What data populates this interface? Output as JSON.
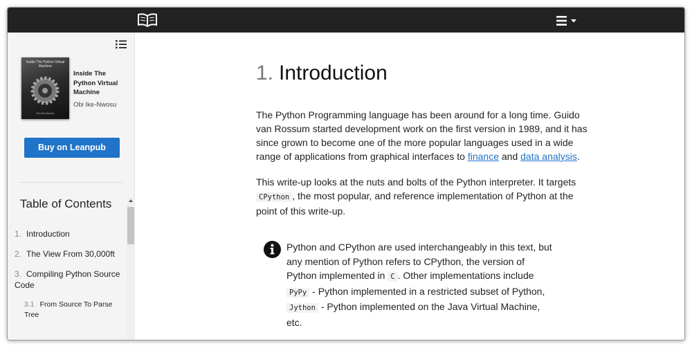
{
  "topbar": {
    "logo_icon": "open-book-icon",
    "menu_icon": "hamburger-menu-icon",
    "menu_caret_icon": "caret-down-icon",
    "background": "#222222"
  },
  "sidebar": {
    "toc_toggle_icon": "list-icon",
    "cover": {
      "title": "Inside The Python Virtual Machine",
      "author": "Obi Ike-Nwosu"
    },
    "book_title": "Inside The Python Virtual Machine",
    "book_author": "Obi Ike-Nwosu",
    "buy_button": "Buy on Leanpub",
    "buy_button_color": "#1f73c8",
    "toc_heading": "Table of Contents",
    "toc": [
      {
        "num": "1.",
        "label": "Introduction"
      },
      {
        "num": "2.",
        "label": "The View From 30,000ft"
      },
      {
        "num": "3.",
        "label": "Compiling Python Source Code"
      },
      {
        "num": "3.1",
        "label": "From Source To Parse Tree"
      }
    ]
  },
  "content": {
    "title_num": "1.",
    "title": "Introduction",
    "p1": {
      "text": "The Python Programming language has been around for a long time. Guido van Rossum started development work on the first version in 1989, and it has since grown to become one of the more popular languages used in a wide range of applications from graphical interfaces to ",
      "link1": "finance",
      "mid": " and ",
      "link2": "data analysis",
      "end": "."
    },
    "p2": {
      "a": "This write-up looks at the nuts and bolts of the Python interpreter. It targets ",
      "code": "CPython",
      "b": ", the most popular, and reference implementation of Python at the point of this write-up."
    },
    "callout": {
      "icon": "info-icon",
      "a": "Python and CPython are used interchangeably in this text, but any mention of Python refers to CPython, the version of Python implemented in ",
      "code1": "C",
      "b": ". Other implementations include ",
      "code2": "PyPy",
      "c": " - Python implemented in a restricted subset of Python, ",
      "code3": "Jython",
      "d": " - Python implemented on the Java Virtual Machine, etc."
    },
    "link_color": "#1f73c8"
  }
}
